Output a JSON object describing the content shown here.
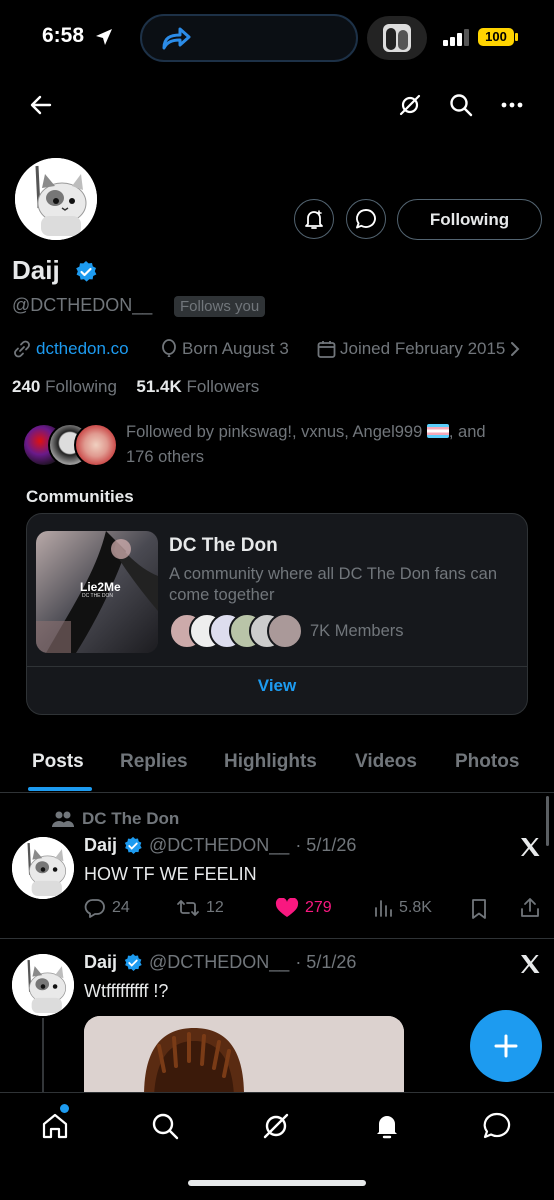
{
  "status_bar": {
    "time": "6:58",
    "battery": "100"
  },
  "profile": {
    "display_name": "Daij",
    "handle": "@DCTHEDON__",
    "follows_you_badge": "Follows you",
    "website": "dcthedon.co",
    "birthday": "Born August 3",
    "joined": "Joined February 2015",
    "following_count": "240",
    "following_label": "Following",
    "followers_count": "51.4K",
    "followers_label": "Followers",
    "followed_by_text": "Followed by pinkswag!, vxnus, Angel999",
    "followed_by_rest": ", and",
    "followed_by_others": "176 others",
    "following_button": "Following"
  },
  "communities": {
    "title": "Communities",
    "card": {
      "name": "DC The Don",
      "description": "A community where all DC The Don fans can come together",
      "members": "7K Members",
      "view_label": "View",
      "image_caption": "Lie2Me",
      "image_subcaption": "DC THE DON"
    }
  },
  "tabs": [
    "Posts",
    "Replies",
    "Highlights",
    "Videos",
    "Photos"
  ],
  "posts": [
    {
      "context": "DC The Don",
      "name": "Daij",
      "handle": "@DCTHEDON__",
      "date": "· 5/1/26",
      "text": "HOW TF WE FEELIN",
      "replies": "24",
      "reposts": "12",
      "likes": "279",
      "views": "5.8K"
    },
    {
      "name": "Daij",
      "handle": "@DCTHEDON__",
      "date": "· 5/1/26",
      "text": "Wtfffffffff !?"
    }
  ],
  "colors": {
    "accent": "#1d9bf0",
    "like": "#f91880",
    "muted": "#71767b",
    "background": "#000000"
  },
  "icons": {
    "nav": [
      "home-icon",
      "search-icon",
      "grok-icon",
      "notifications-icon",
      "messages-icon"
    ]
  }
}
